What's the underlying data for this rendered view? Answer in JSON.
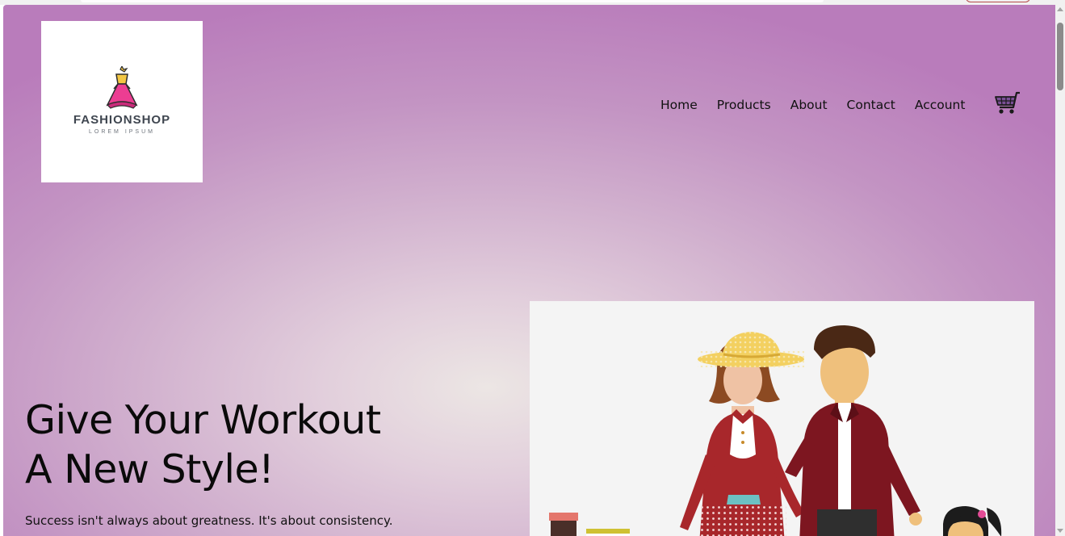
{
  "brand": {
    "name": "FASHIONSHOP",
    "tagline": "LOREM IPSUM",
    "logo_icon": "dress-icon"
  },
  "nav": {
    "items": [
      {
        "label": "Home"
      },
      {
        "label": "Products"
      },
      {
        "label": "About"
      },
      {
        "label": "Contact"
      },
      {
        "label": "Account"
      }
    ],
    "cart_icon": "shopping-cart-icon"
  },
  "hero": {
    "title_line1": "Give Your Workout",
    "title_line2": "A New Style!",
    "subtitle": "Success isn't always about greatness. It's about consistency.",
    "image_icon": "fashion-couple-illustration"
  },
  "colors": {
    "gradient_edge": "#b97cbb",
    "gradient_center": "#ece6e4",
    "dress_pink": "#e83e8c",
    "jacket_red": "#8b1a22",
    "hat_yellow": "#f3d060"
  }
}
